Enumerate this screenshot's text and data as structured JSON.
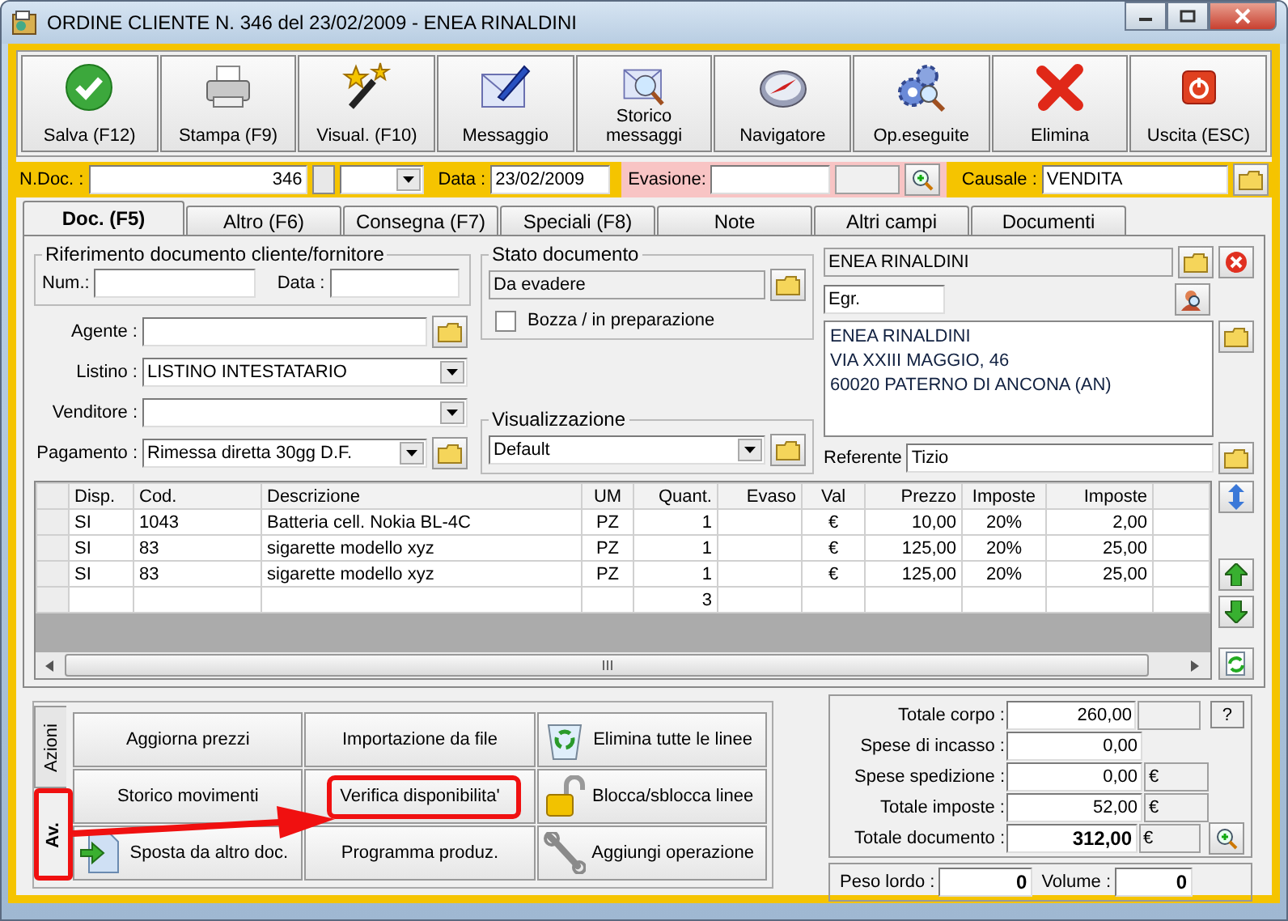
{
  "window": {
    "title": "ORDINE CLIENTE N. 346  del 23/02/2009 - ENEA RINALDINI"
  },
  "toolbar": [
    {
      "label": "Salva (F12)"
    },
    {
      "label": "Stampa (F9)"
    },
    {
      "label": "Visual. (F10)"
    },
    {
      "label": "Messaggio"
    },
    {
      "label": "Storico messaggi"
    },
    {
      "label": "Navigatore"
    },
    {
      "label": "Op.eseguite"
    },
    {
      "label": "Elimina"
    },
    {
      "label": "Uscita (ESC)"
    }
  ],
  "header": {
    "ndoc_label": "N.Doc. :",
    "ndoc": "346",
    "data_label": "Data :",
    "data": "23/02/2009",
    "evasione_label": "Evasione:",
    "causale_label": "Causale :",
    "causale": "VENDITA"
  },
  "tabs": [
    {
      "label": "Doc. (F5)",
      "selected": true
    },
    {
      "label": "Altro (F6)",
      "selected": false
    },
    {
      "label": "Consegna (F7)",
      "selected": false
    },
    {
      "label": "Speciali (F8)",
      "selected": false
    },
    {
      "label": "Note",
      "selected": false
    },
    {
      "label": "Altri campi",
      "selected": false
    },
    {
      "label": "Documenti",
      "selected": false
    }
  ],
  "riferimento": {
    "title": "Riferimento documento cliente/fornitore",
    "num_label": "Num.:",
    "data_label": "Data :"
  },
  "fields": [
    {
      "kind": "text",
      "label": "Agente :"
    },
    {
      "kind": "combo",
      "label": "Listino :",
      "value": "LISTINO INTESTATARIO"
    },
    {
      "kind": "combo",
      "label": "Venditore :"
    },
    {
      "kind": "combo-folder",
      "label": "Pagamento :",
      "value": "Rimessa diretta 30gg D.F."
    }
  ],
  "stato": {
    "title": "Stato documento",
    "value": "Da evadere",
    "checkbox_label": "Bozza / in preparazione",
    "checked": false
  },
  "visualizzazione": {
    "title": "Visualizzazione",
    "value": "Default"
  },
  "cliente": {
    "name": "ENEA RINALDINI",
    "salutation": "Egr.",
    "address": [
      "ENEA RINALDINI",
      "VIA XXIII MAGGIO, 46",
      "60020 PATERNO DI ANCONA (AN)"
    ],
    "referente_label": "Referente",
    "referente": "Tizio"
  },
  "table": {
    "columns": [
      "Disp.",
      "Cod.",
      "Descrizione",
      "UM",
      "Quant.",
      "Evaso",
      "Val",
      "Prezzo",
      "Imposte",
      "Imposte"
    ],
    "rows": [
      {
        "cells": [
          "SI",
          "1043",
          "Batteria cell. Nokia BL-4C",
          "PZ",
          "1",
          "",
          "€",
          "10,00",
          "20%",
          "2,00"
        ]
      },
      {
        "cells": [
          "SI",
          "83",
          "sigarette modello xyz",
          "PZ",
          "1",
          "",
          "€",
          "125,00",
          "20%",
          "25,00"
        ]
      },
      {
        "cells": [
          "SI",
          "83",
          "sigarette modello xyz",
          "PZ",
          "1",
          "",
          "€",
          "125,00",
          "20%",
          "25,00"
        ]
      }
    ],
    "total_quant": "3"
  },
  "side_tabs": [
    {
      "label": "Azioni",
      "selected": false,
      "highlighted": false
    },
    {
      "label": "Av.",
      "selected": true,
      "highlighted": true
    }
  ],
  "actions": [
    {
      "label": "Aggiorna prezzi",
      "highlighted": false
    },
    {
      "label": "Importazione da file",
      "highlighted": false
    },
    {
      "label": "Elimina tutte le linee",
      "highlighted": false
    },
    {
      "label": "Storico movimenti",
      "highlighted": false
    },
    {
      "label": "Verifica disponibilita'",
      "highlighted": true
    },
    {
      "label": "Blocca/sblocca linee",
      "highlighted": false
    },
    {
      "label": "Sposta da altro doc.",
      "highlighted": false
    },
    {
      "label": "Programma produz.",
      "highlighted": false
    },
    {
      "label": "Aggiungi operazione",
      "highlighted": false
    }
  ],
  "totals": [
    {
      "kind": "corpo",
      "label": "Totale corpo :",
      "value": "260,00",
      "help": "?"
    },
    {
      "kind": "plain",
      "label": "Spese di incasso :",
      "value": "0,00"
    },
    {
      "kind": "currency",
      "label": "Spese spedizione :",
      "value": "0,00",
      "currency": "€"
    },
    {
      "kind": "currency",
      "label": "Totale imposte :",
      "value": "52,00",
      "currency": "€"
    },
    {
      "kind": "total",
      "label": "Totale documento :",
      "value": "312,00",
      "currency": "€"
    }
  ],
  "peso": {
    "peso_label": "Peso lordo :",
    "peso": "0",
    "volume_label": "Volume :",
    "volume": "0"
  }
}
